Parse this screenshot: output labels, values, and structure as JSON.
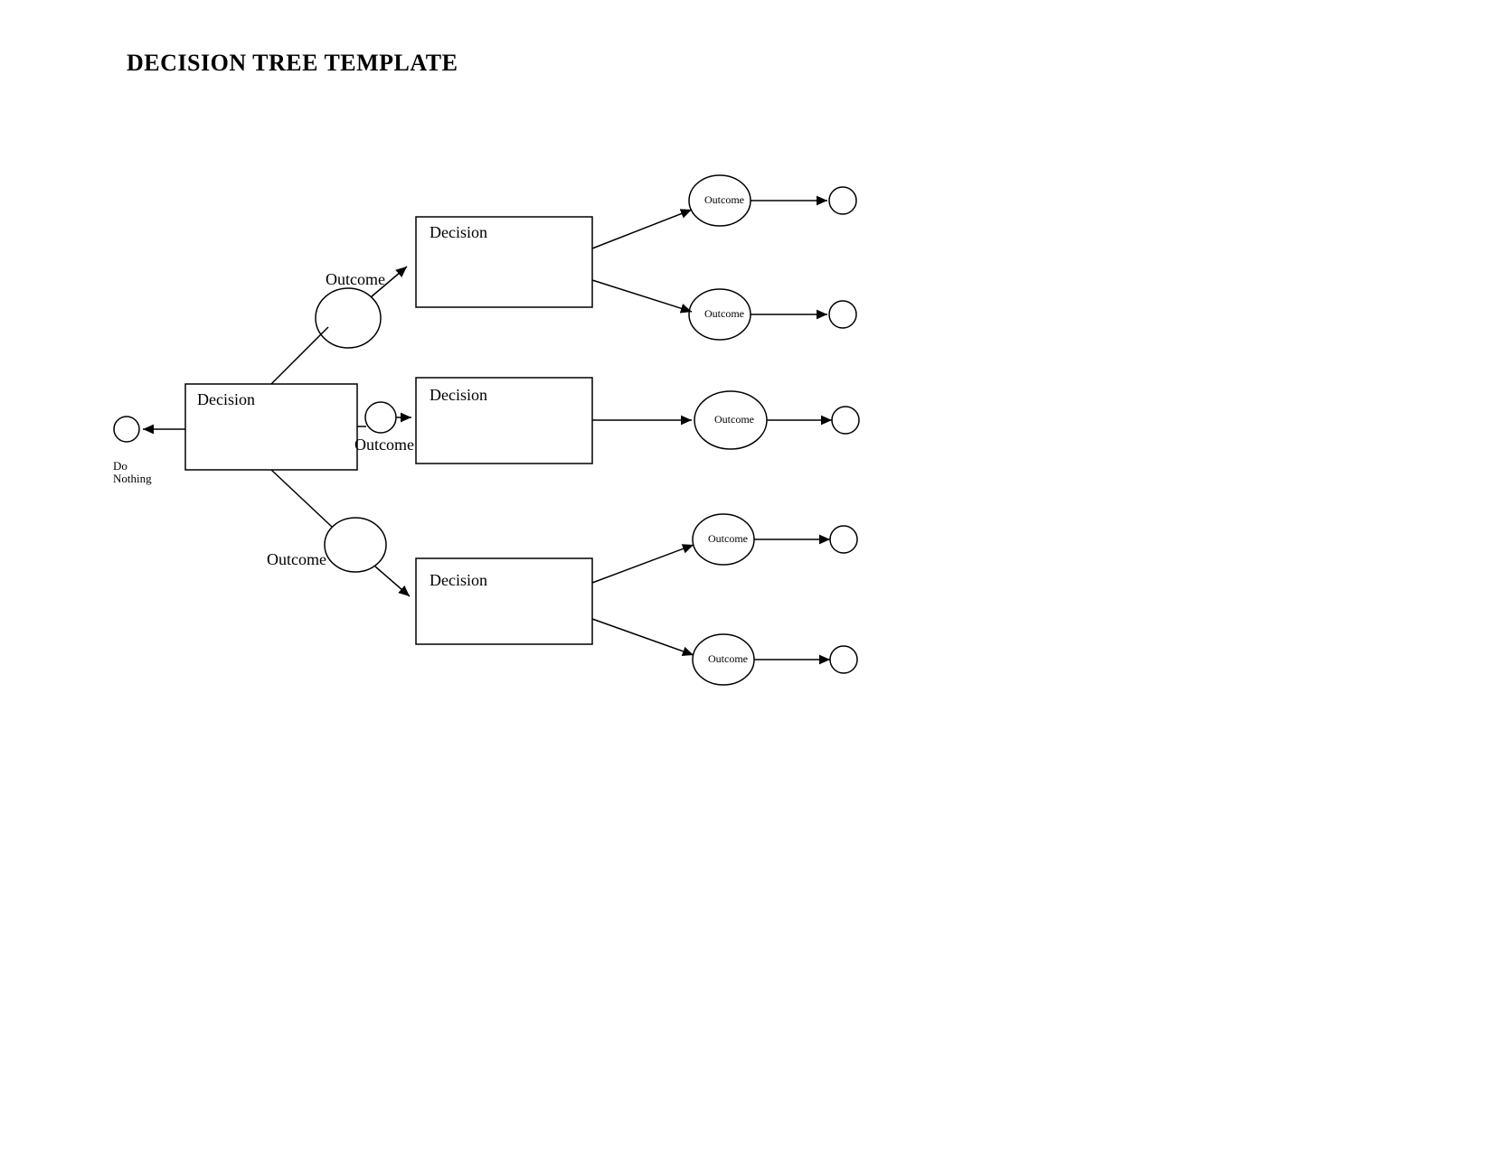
{
  "title": "DECISION TREE TEMPLATE",
  "doNothing": "Do\nNothing",
  "root": {
    "label": "Decision"
  },
  "branches": {
    "top": {
      "outcome": "Outcome",
      "decision": "Decision",
      "outcome1": "Outcome",
      "outcome2": "Outcome"
    },
    "middle": {
      "outcome": "Outcome",
      "decision": "Decision",
      "outcome1": "Outcome"
    },
    "bottom": {
      "outcome": "Outcome",
      "decision": "Decision",
      "outcome1": "Outcome",
      "outcome2": "Outcome"
    }
  }
}
